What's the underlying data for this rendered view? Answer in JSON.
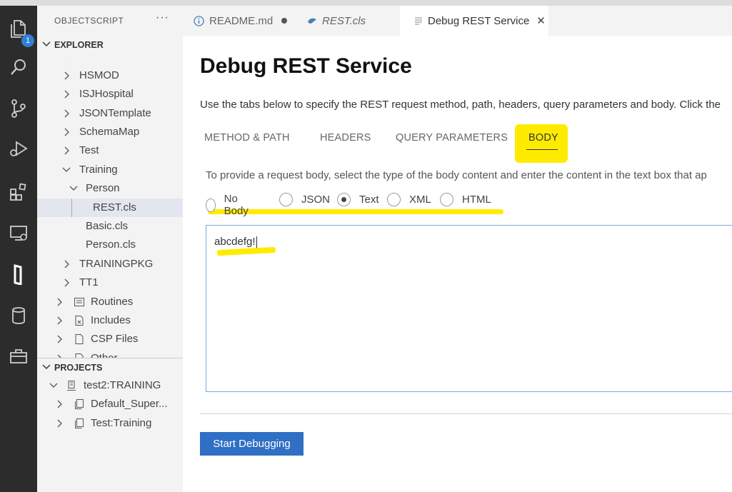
{
  "sidebar": {
    "title": "OBJECTSCRIPT",
    "more": "···",
    "explorer_label": "EXPLORER",
    "projects_label": "PROJECTS",
    "tree": [
      {
        "label": "HS"
      },
      {
        "label": "HSMOD"
      },
      {
        "label": "ISJHospital"
      },
      {
        "label": "JSONTemplate"
      },
      {
        "label": "SchemaMap"
      },
      {
        "label": "Test"
      },
      {
        "label": "Training"
      },
      {
        "label": "Person"
      },
      {
        "label": "REST.cls"
      },
      {
        "label": "Basic.cls"
      },
      {
        "label": "Person.cls"
      },
      {
        "label": "TRAININGPKG"
      },
      {
        "label": "TT1"
      },
      {
        "label": "Routines"
      },
      {
        "label": "Includes"
      },
      {
        "label": "CSP Files"
      },
      {
        "label": "Other"
      }
    ],
    "projects": [
      {
        "label": "test2:TRAINING"
      },
      {
        "label": "Default_Super..."
      },
      {
        "label": "Test:Training"
      }
    ]
  },
  "activity": {
    "badge": "1"
  },
  "tabs": [
    {
      "label": "README.md",
      "modified": true
    },
    {
      "label": "REST.cls"
    },
    {
      "label": "Debug REST Service",
      "active": true
    }
  ],
  "tab_close": "✕",
  "page": {
    "title": "Debug REST Service",
    "description": "Use the tabs below to specify the REST request method, path, headers, query parameters and body. Click the",
    "tabs": [
      "METHOD & PATH",
      "HEADERS",
      "QUERY PARAMETERS",
      "BODY"
    ],
    "body_description": "To provide a request body, select the type of the body content and enter the content in the text box that ap",
    "body_types": [
      "No Body",
      "JSON",
      "Text",
      "XML",
      "HTML"
    ],
    "selected_body_type": "Text",
    "body_value": "abcdefg!",
    "start_button": "Start Debugging"
  },
  "colors": {
    "accent": "#2f6fc4",
    "highlight": "#ffeb00",
    "badge": "#2f7fd7"
  }
}
